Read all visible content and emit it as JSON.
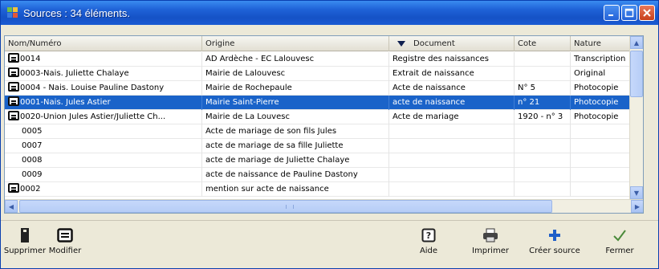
{
  "window": {
    "title": "Sources : 34 éléments."
  },
  "grid": {
    "columns": [
      "Nom/Numéro",
      "Origine",
      "Document",
      "Cote",
      "Nature"
    ],
    "sorted_column": "Document",
    "rows": [
      {
        "icon": true,
        "nom": "0014",
        "origine": "AD Ardèche - EC Lalouvesc",
        "document": "Registre des naissances",
        "cote": "",
        "nature": "Transcription"
      },
      {
        "icon": true,
        "nom": "0003-Nais. Juliette Chalaye",
        "origine": "Mairie de Lalouvesc",
        "document": "Extrait de naissance",
        "cote": "",
        "nature": "Original"
      },
      {
        "icon": true,
        "nom": "0004 - Nais. Louise Pauline Dastony",
        "origine": "Mairie de Rochepaule",
        "document": "Acte de naissance",
        "cote": "N° 5",
        "nature": "Photocopie"
      },
      {
        "icon": true,
        "nom": "0001-Nais. Jules Astier",
        "origine": "Mairie Saint-Pierre",
        "document": "acte de naissance",
        "cote": "n° 21",
        "nature": "Photocopie",
        "selected": true
      },
      {
        "icon": true,
        "nom": "0020-Union Jules Astier/Juliette Ch...",
        "origine": "Mairie de La Louvesc",
        "document": "Acte de mariage",
        "cote": "1920 - n° 3",
        "nature": "Photocopie"
      },
      {
        "icon": false,
        "nom": "0005",
        "origine": "Acte de mariage de son fils Jules",
        "document": "",
        "cote": "",
        "nature": ""
      },
      {
        "icon": false,
        "nom": "0007",
        "origine": "acte de mariage de sa fille Juliette",
        "document": "",
        "cote": "",
        "nature": ""
      },
      {
        "icon": false,
        "nom": "0008",
        "origine": "acte de mariage de Juliette Chalaye",
        "document": "",
        "cote": "",
        "nature": ""
      },
      {
        "icon": false,
        "nom": "0009",
        "origine": "acte de naissance de Pauline Dastony",
        "document": "",
        "cote": "",
        "nature": ""
      },
      {
        "icon": true,
        "nom": "0002",
        "origine": "mention sur acte de naissance",
        "document": "",
        "cote": "",
        "nature": ""
      }
    ]
  },
  "toolbar": {
    "supprimer": "Supprimer",
    "modifier": "Modifier",
    "aide": "Aide",
    "imprimer": "Imprimer",
    "creer_source": "Créer source",
    "fermer": "Fermer"
  },
  "colors": {
    "titlebar": "#1f63d8",
    "selection": "#1a63c9",
    "add_icon": "#1f5fc8",
    "check_icon": "#4a8a3a"
  }
}
